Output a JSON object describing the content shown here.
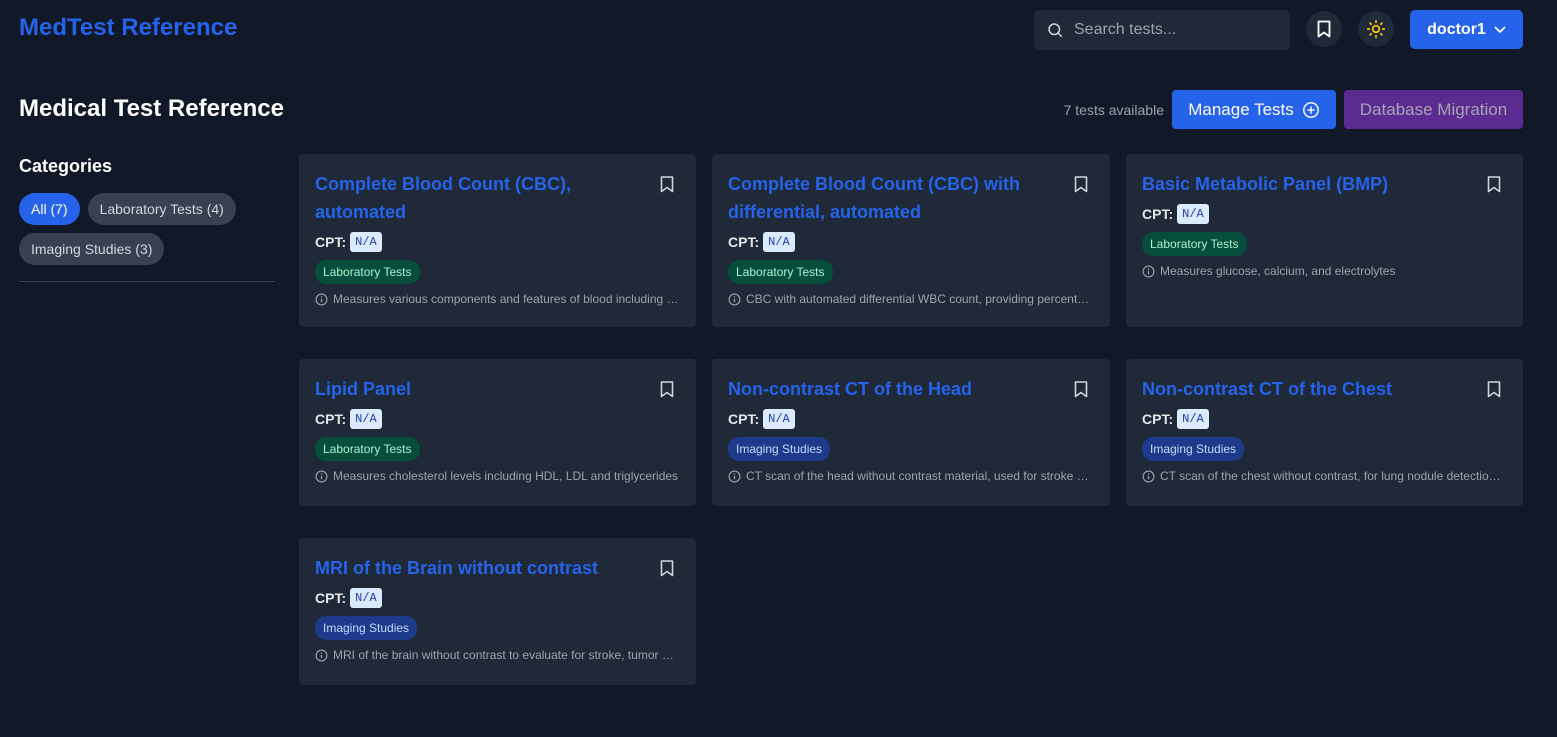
{
  "app": {
    "brand": "MedTest Reference"
  },
  "header": {
    "search_placeholder": "Search tests...",
    "user_label": "doctor1"
  },
  "page": {
    "title": "Medical Test Reference",
    "count_text": "7 tests available",
    "manage_label": "Manage Tests",
    "migration_label": "Database Migration"
  },
  "sidebar": {
    "title": "Categories",
    "chips": [
      {
        "label": "All (7)",
        "active": true
      },
      {
        "label": "Laboratory Tests (4)",
        "active": false
      },
      {
        "label": "Imaging Studies (3)",
        "active": false
      }
    ]
  },
  "tests": [
    {
      "title": "Complete Blood Count (CBC), automated",
      "cpt_label": "CPT:",
      "cpt": "N/A",
      "category": "Laboratory Tests",
      "description": "Measures various components and features of blood including red and white cells"
    },
    {
      "title": "Complete Blood Count (CBC) with differential, automated",
      "cpt_label": "CPT:",
      "cpt": "N/A",
      "category": "Laboratory Tests",
      "description": "CBC with automated differential WBC count, providing percentages of each type"
    },
    {
      "title": "Basic Metabolic Panel (BMP)",
      "cpt_label": "CPT:",
      "cpt": "N/A",
      "category": "Laboratory Tests",
      "description": "Measures glucose, calcium, and electrolytes"
    },
    {
      "title": "Lipid Panel",
      "cpt_label": "CPT:",
      "cpt": "N/A",
      "category": "Laboratory Tests",
      "description": "Measures cholesterol levels including HDL, LDL and triglycerides"
    },
    {
      "title": "Non-contrast CT of the Head",
      "cpt_label": "CPT:",
      "cpt": "N/A",
      "category": "Imaging Studies",
      "description": "CT scan of the head without contrast material, used for stroke and trauma"
    },
    {
      "title": "Non-contrast CT of the Chest",
      "cpt_label": "CPT:",
      "cpt": "N/A",
      "category": "Imaging Studies",
      "description": "CT scan of the chest without contrast, for lung nodule detection and follow-up"
    },
    {
      "title": "MRI of the Brain without contrast",
      "cpt_label": "CPT:",
      "cpt": "N/A",
      "category": "Imaging Studies",
      "description": "MRI of the brain without contrast to evaluate for stroke, tumor and other lesions"
    }
  ],
  "colors": {
    "background": "#111827",
    "card": "#1f2937",
    "accent": "#2563eb",
    "migration": "#5b2b91",
    "lab_badge": "#064e3b",
    "imaging_badge": "#1e3a8a"
  }
}
